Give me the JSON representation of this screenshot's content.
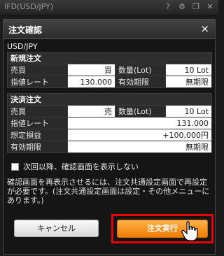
{
  "app": {
    "title": "IFD(USD/JPY)",
    "icons": [
      "help-icon",
      "gear-icon",
      "restore-icon",
      "close-icon"
    ]
  },
  "dialog": {
    "title": "注文確認",
    "close": "×"
  },
  "pair": "USD/JPY",
  "new_order": {
    "section": "新規注文",
    "rows": [
      {
        "l1": "売買",
        "v1": "買",
        "l2": "数量(Lot)",
        "v2": "10 Lot"
      },
      {
        "l1": "指値レート",
        "v1": "130.000",
        "l2": "有効期限",
        "v2": "無期限"
      }
    ]
  },
  "settle_order": {
    "section": "決済注文",
    "row1": {
      "l1": "売買",
      "v1": "売",
      "l2": "数量(Lot)",
      "v2": "10 Lot"
    },
    "rows": [
      {
        "label": "指値レート",
        "value": "131.000"
      },
      {
        "label": "想定損益",
        "value": "+100,000円"
      },
      {
        "label": "有効期限",
        "value": "無期限"
      }
    ]
  },
  "checkbox_label": "次回以降、確認画面を表示しない",
  "notice": "確認画面を再表示させるには、注文共通設定画面で再設定が必要です。(注文共通設定画面は設定・その他メニューにあります。)",
  "buttons": {
    "cancel": "キャンセル",
    "execute": "注文実行"
  },
  "colors": {
    "buy": "#d81b2a",
    "sell": "#1a8ad4",
    "execute": "#f07b00",
    "highlight": "#e8000b"
  }
}
